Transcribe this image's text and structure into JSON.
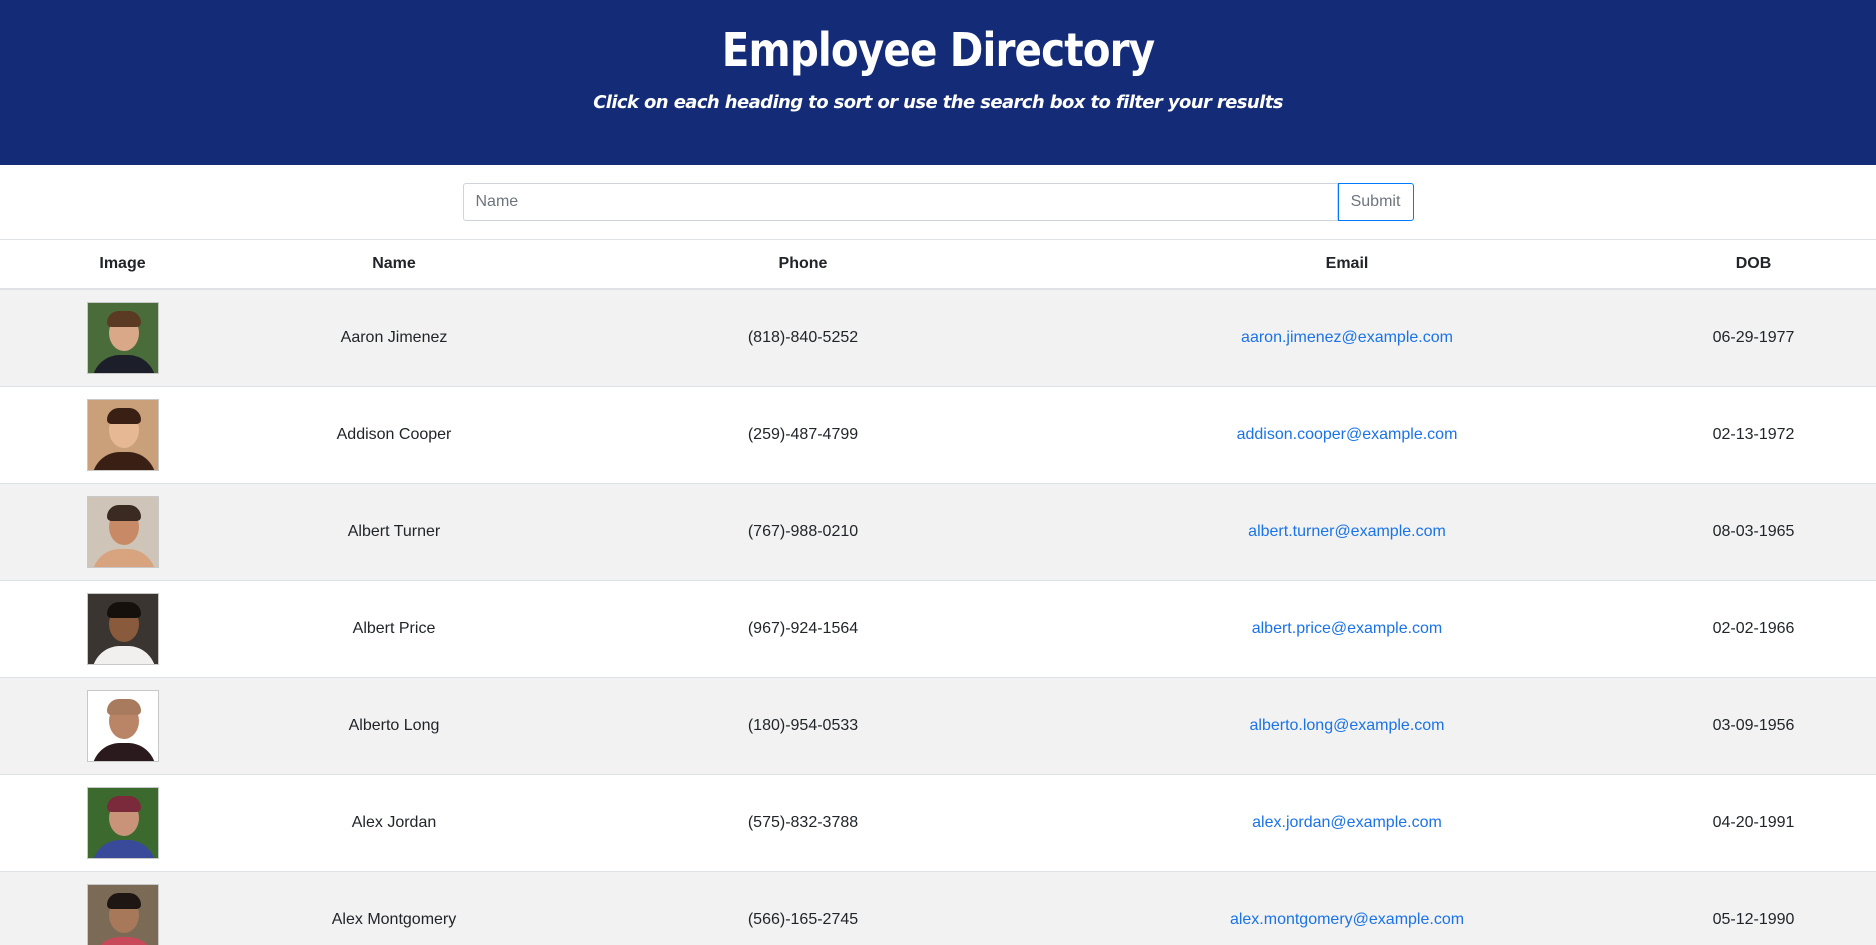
{
  "header": {
    "title": "Employee Directory",
    "subtitle": "Click on each heading to sort or use the search box to filter your results"
  },
  "search": {
    "placeholder": "Name",
    "value": "",
    "submit_label": "Submit"
  },
  "table": {
    "columns": [
      "Image",
      "Name",
      "Phone",
      "Email",
      "DOB"
    ],
    "rows": [
      {
        "name": "Aaron Jimenez",
        "phone": "(818)-840-5252",
        "email": "aaron.jimenez@example.com",
        "dob": "06-29-1977",
        "avatar": {
          "bg": "#4a6b3a",
          "skin": "#d9a888",
          "hair": "#5a3a22",
          "shirt": "#1c1f2a"
        }
      },
      {
        "name": "Addison Cooper",
        "phone": "(259)-487-4799",
        "email": "addison.cooper@example.com",
        "dob": "02-13-1972",
        "avatar": {
          "bg": "#c9a07a",
          "skin": "#e7b894",
          "hair": "#3a1f14",
          "shirt": "#3a1f14"
        }
      },
      {
        "name": "Albert Turner",
        "phone": "(767)-988-0210",
        "email": "albert.turner@example.com",
        "dob": "08-03-1965",
        "avatar": {
          "bg": "#cfc4b8",
          "skin": "#c88a66",
          "hair": "#3b2a22",
          "shirt": "#d8a47f"
        }
      },
      {
        "name": "Albert Price",
        "phone": "(967)-924-1564",
        "email": "albert.price@example.com",
        "dob": "02-02-1966",
        "avatar": {
          "bg": "#3a3530",
          "skin": "#8a5a3c",
          "hair": "#15100c",
          "shirt": "#f2f0ee"
        }
      },
      {
        "name": "Alberto Long",
        "phone": "(180)-954-0533",
        "email": "alberto.long@example.com",
        "dob": "03-09-1956",
        "avatar": {
          "bg": "#ffffff",
          "skin": "#b98566",
          "hair": "#a87a5e",
          "shirt": "#2a1a1e"
        }
      },
      {
        "name": "Alex Jordan",
        "phone": "(575)-832-3788",
        "email": "alex.jordan@example.com",
        "dob": "04-20-1991",
        "avatar": {
          "bg": "#3c6a2e",
          "skin": "#c9937a",
          "hair": "#7a2a3a",
          "shirt": "#3a4a9a"
        }
      },
      {
        "name": "Alex Montgomery",
        "phone": "(566)-165-2745",
        "email": "alex.montgomery@example.com",
        "dob": "05-12-1990",
        "avatar": {
          "bg": "#7a6a56",
          "skin": "#a8785a",
          "hair": "#1e1612",
          "shirt": "#c84a5a"
        }
      }
    ]
  }
}
